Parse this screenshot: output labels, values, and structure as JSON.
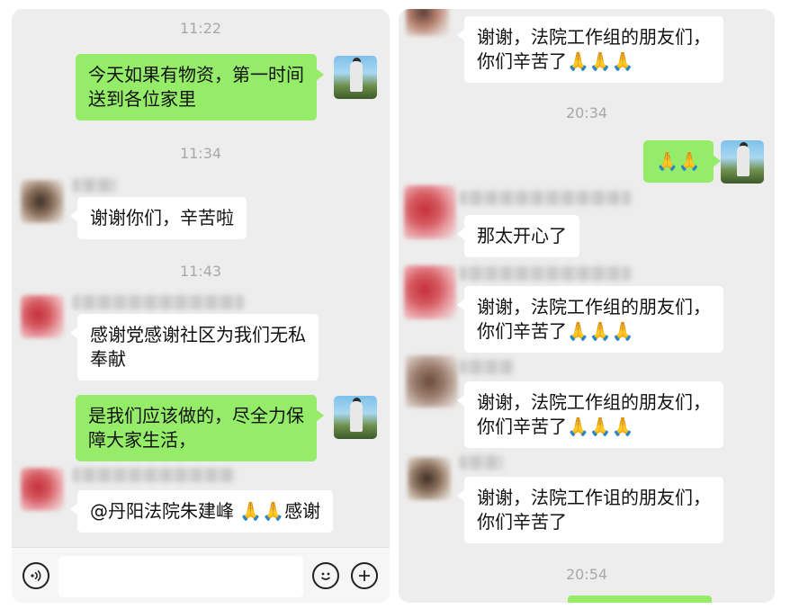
{
  "left_chat": {
    "messages": [
      {
        "type": "time",
        "text": "11:22"
      },
      {
        "type": "sent",
        "line1": "今天如果有物资，第一时间",
        "line2": "送到各位家里"
      },
      {
        "type": "time",
        "text": "11:34"
      },
      {
        "type": "received",
        "line1": "谢谢你们，辛苦啦"
      },
      {
        "type": "time",
        "text": "11:43"
      },
      {
        "type": "received",
        "line1": "感谢党感谢社区为我们无私",
        "line2": "奉献"
      },
      {
        "type": "sent",
        "line1": "是我们应该做的，尽全力保",
        "line2": "障大家生活，"
      },
      {
        "type": "received",
        "line1": "@丹阳法院朱建峰 🙏🙏感谢"
      }
    ],
    "input_bar": {
      "voice_icon": "voice-icon",
      "emoji_icon": "emoji-icon",
      "plus_icon": "plus-icon"
    }
  },
  "right_chat": {
    "messages": [
      {
        "type": "received",
        "line1": "谢谢，法院工作组的朋友们，",
        "line2": "你们辛苦了🙏🙏🙏"
      },
      {
        "type": "time",
        "text": "20:34"
      },
      {
        "type": "sent",
        "line1": "🙏🙏"
      },
      {
        "type": "received",
        "line1": "那太开心了"
      },
      {
        "type": "received",
        "line1": "谢谢，法院工作组的朋友们，",
        "line2": "你们辛苦了🙏🙏🙏"
      },
      {
        "type": "received",
        "line1": "谢谢，法院工作组的朋友们，",
        "line2": "你们辛苦了🙏🙏🙏"
      },
      {
        "type": "received",
        "line1": "谢谢，法院工作诅的朋友们，",
        "line2": "你们辛苦了"
      },
      {
        "type": "time",
        "text": "20:54"
      }
    ]
  },
  "colors": {
    "background": "#ededed",
    "sent_bubble": "#95ec69",
    "received_bubble": "#ffffff",
    "timestamp": "#a8a8a8"
  }
}
